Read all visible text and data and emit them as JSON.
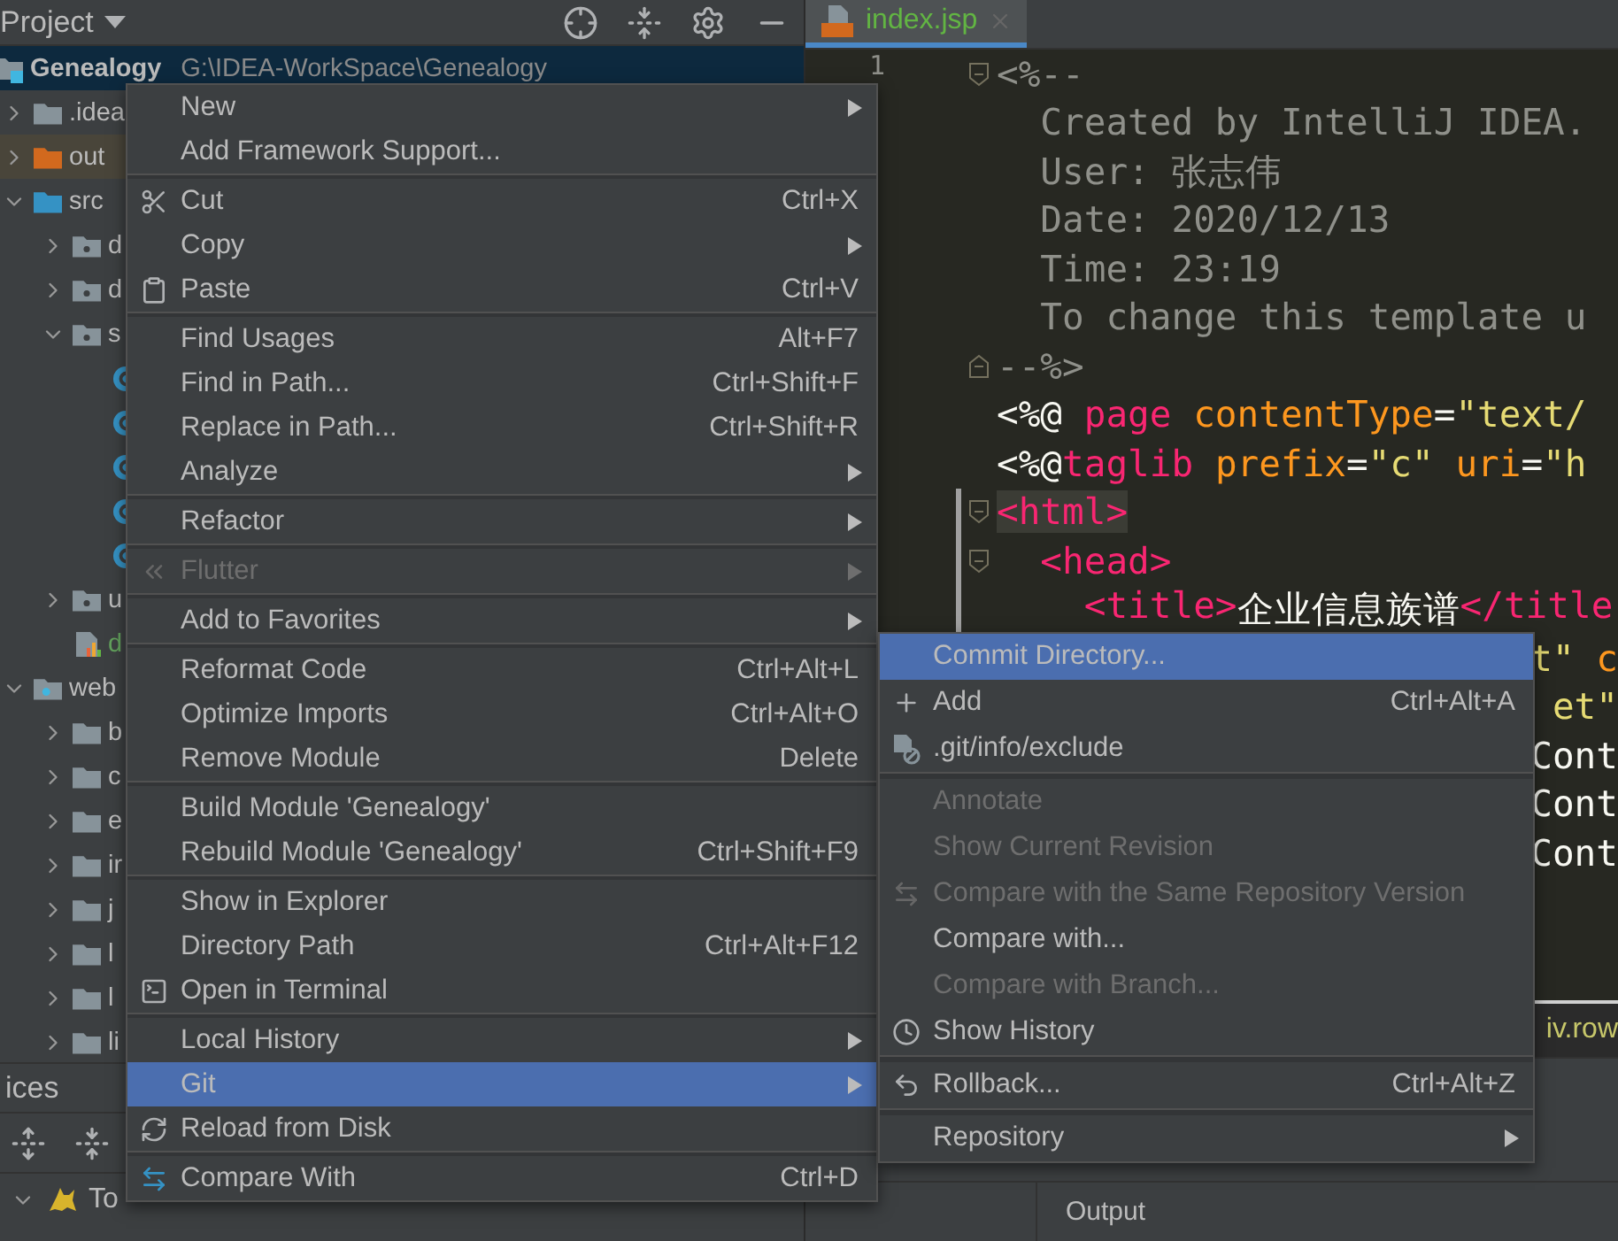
{
  "project_panel": {
    "title": "Project",
    "tree": [
      {
        "name": "Genealogy",
        "path": "G:\\IDEA-WorkSpace\\Genealogy",
        "kind": "module",
        "selected": true,
        "children": [
          {
            "name": ".idea",
            "kind": "folder",
            "expanded": false,
            "selected": false
          },
          {
            "name": "out",
            "kind": "excluded",
            "expanded": false,
            "selected": false
          },
          {
            "name": "src",
            "kind": "source",
            "expanded": true,
            "selected": false,
            "children": [
              {
                "name": "d",
                "kind": "package",
                "expanded": false,
                "selected": false
              },
              {
                "name": "d",
                "kind": "package",
                "expanded": false,
                "selected": false
              },
              {
                "name": "s",
                "kind": "package",
                "expanded": true,
                "selected": false,
                "children": [
                  {
                    "kind": "class",
                    "selected": false
                  },
                  {
                    "kind": "class",
                    "selected": false
                  },
                  {
                    "kind": "class",
                    "selected": false
                  },
                  {
                    "kind": "class",
                    "selected": false
                  },
                  {
                    "kind": "class",
                    "selected": false
                  }
                ]
              },
              {
                "name": "u",
                "kind": "package",
                "expanded": false,
                "selected": false
              },
              {
                "name": "d",
                "kind": "file",
                "selected": false
              }
            ]
          },
          {
            "name": "web",
            "kind": "webroot",
            "expanded": true,
            "selected": false,
            "children": [
              {
                "name": "b",
                "kind": "folder",
                "expanded": false,
                "selected": false
              },
              {
                "name": "c",
                "kind": "folder",
                "expanded": false,
                "selected": false
              },
              {
                "name": "e",
                "kind": "folder",
                "expanded": false,
                "selected": false
              },
              {
                "name": "ir",
                "kind": "folder",
                "expanded": false,
                "selected": false
              },
              {
                "name": "j",
                "kind": "folder",
                "expanded": false,
                "selected": false
              },
              {
                "name": "l",
                "kind": "folder",
                "expanded": false,
                "selected": false
              },
              {
                "name": "l",
                "kind": "folder",
                "expanded": false,
                "selected": false
              },
              {
                "name": "li",
                "kind": "folder",
                "expanded": false,
                "selected": false
              }
            ]
          }
        ]
      }
    ]
  },
  "services_panel": {
    "title": "ices",
    "rows": [
      {
        "name": "To",
        "expanded": true
      }
    ]
  },
  "editor": {
    "tabs": [
      {
        "label": "index.jsp",
        "selected": true
      }
    ],
    "lines": [
      {
        "kind": "fold-start",
        "number": "1",
        "tokens": [
          {
            "text": "<%--",
            "kind": "comment"
          }
        ]
      },
      {
        "kind": "code",
        "tokens": [
          {
            "text": "  Created by IntelliJ IDEA.",
            "kind": "comment"
          }
        ]
      },
      {
        "kind": "code",
        "tokens": [
          {
            "text": "  User: 张志伟",
            "kind": "comment"
          }
        ]
      },
      {
        "kind": "code",
        "tokens": [
          {
            "text": "  Date: 2020/12/13",
            "kind": "comment"
          }
        ]
      },
      {
        "kind": "code",
        "tokens": [
          {
            "text": "  Time: 23:19",
            "kind": "comment"
          }
        ]
      },
      {
        "kind": "code",
        "tokens": [
          {
            "text": "  To change this template u",
            "kind": "comment"
          }
        ]
      },
      {
        "kind": "fold-end",
        "tokens": [
          {
            "text": "--%>",
            "kind": "comment"
          }
        ]
      },
      {
        "kind": "code",
        "tokens": [
          {
            "text": "<%@ ",
            "kind": "plain"
          },
          {
            "text": "page ",
            "kind": "tag"
          },
          {
            "text": "contentType",
            "kind": "attr"
          },
          {
            "text": "=",
            "kind": "plain"
          },
          {
            "text": "\"text/",
            "kind": "string"
          }
        ]
      },
      {
        "kind": "code",
        "tokens": [
          {
            "text": "<%@",
            "kind": "plain"
          },
          {
            "text": "taglib ",
            "kind": "tag"
          },
          {
            "text": "prefix",
            "kind": "attr"
          },
          {
            "text": "=",
            "kind": "plain"
          },
          {
            "text": "\"c\" ",
            "kind": "string"
          },
          {
            "text": "uri",
            "kind": "attr"
          },
          {
            "text": "=",
            "kind": "plain"
          },
          {
            "text": "\"h",
            "kind": "string"
          }
        ]
      },
      {
        "kind": "fold-start",
        "changed": true,
        "tokens": [
          {
            "text": "<html>",
            "kind": "tag",
            "matched": true
          }
        ]
      },
      {
        "kind": "fold-start",
        "changed": true,
        "tokens": [
          {
            "text": "  <head>",
            "kind": "tag"
          }
        ]
      },
      {
        "kind": "code",
        "changed": true,
        "tokens": [
          {
            "text": "    <title>",
            "kind": "tag"
          },
          {
            "text": "企业信息族谱",
            "kind": "plain"
          },
          {
            "text": "</title",
            "kind": "tag"
          }
        ]
      },
      {
        "kind": "fragment",
        "tokens": [
          {
            "text": "t\" ",
            "kind": "string"
          },
          {
            "text": "c",
            "kind": "attr"
          }
        ]
      },
      {
        "kind": "fragment",
        "tokens": [
          {
            "text": "et\"",
            "kind": "string"
          }
        ]
      },
      {
        "kind": "fragment",
        "tokens": [
          {
            "text": "Cont",
            "kind": "plain"
          }
        ]
      },
      {
        "kind": "fragment",
        "tokens": [
          {
            "text": "Cont",
            "kind": "plain"
          }
        ]
      },
      {
        "kind": "fragment",
        "tokens": [
          {
            "text": "Cont",
            "kind": "plain"
          }
        ]
      }
    ],
    "breadcrumb": "iv.row",
    "bottom_tab": "Output"
  },
  "context_menu": {
    "items": [
      {
        "kind": "item",
        "label": "New",
        "submenu": true,
        "disabled": false,
        "selected": false
      },
      {
        "kind": "item",
        "label": "Add Framework Support...",
        "submenu": false,
        "disabled": false,
        "selected": false
      },
      {
        "kind": "separator"
      },
      {
        "kind": "item",
        "label": "Cut",
        "shortcut": "Ctrl+X",
        "submenu": false,
        "disabled": false,
        "selected": false
      },
      {
        "kind": "item",
        "label": "Copy",
        "submenu": true,
        "disabled": false,
        "selected": false
      },
      {
        "kind": "item",
        "label": "Paste",
        "shortcut": "Ctrl+V",
        "submenu": false,
        "disabled": false,
        "selected": false
      },
      {
        "kind": "separator"
      },
      {
        "kind": "item",
        "label": "Find Usages",
        "shortcut": "Alt+F7",
        "submenu": false,
        "disabled": false,
        "selected": false
      },
      {
        "kind": "item",
        "label": "Find in Path...",
        "shortcut": "Ctrl+Shift+F",
        "submenu": false,
        "disabled": false,
        "selected": false
      },
      {
        "kind": "item",
        "label": "Replace in Path...",
        "shortcut": "Ctrl+Shift+R",
        "submenu": false,
        "disabled": false,
        "selected": false
      },
      {
        "kind": "item",
        "label": "Analyze",
        "submenu": true,
        "disabled": false,
        "selected": false
      },
      {
        "kind": "separator"
      },
      {
        "kind": "item",
        "label": "Refactor",
        "submenu": true,
        "disabled": false,
        "selected": false
      },
      {
        "kind": "separator"
      },
      {
        "kind": "item",
        "label": "Flutter",
        "submenu": true,
        "disabled": true,
        "selected": false
      },
      {
        "kind": "separator"
      },
      {
        "kind": "item",
        "label": "Add to Favorites",
        "submenu": true,
        "disabled": false,
        "selected": false
      },
      {
        "kind": "separator"
      },
      {
        "kind": "item",
        "label": "Reformat Code",
        "shortcut": "Ctrl+Alt+L",
        "submenu": false,
        "disabled": false,
        "selected": false
      },
      {
        "kind": "item",
        "label": "Optimize Imports",
        "shortcut": "Ctrl+Alt+O",
        "submenu": false,
        "disabled": false,
        "selected": false
      },
      {
        "kind": "item",
        "label": "Remove Module",
        "shortcut": "Delete",
        "submenu": false,
        "disabled": false,
        "selected": false
      },
      {
        "kind": "separator"
      },
      {
        "kind": "item",
        "label": "Build Module 'Genealogy'",
        "submenu": false,
        "disabled": false,
        "selected": false
      },
      {
        "kind": "item",
        "label": "Rebuild Module 'Genealogy'",
        "shortcut": "Ctrl+Shift+F9",
        "submenu": false,
        "disabled": false,
        "selected": false
      },
      {
        "kind": "separator"
      },
      {
        "kind": "item",
        "label": "Show in Explorer",
        "submenu": false,
        "disabled": false,
        "selected": false
      },
      {
        "kind": "item",
        "label": "Directory Path",
        "shortcut": "Ctrl+Alt+F12",
        "submenu": false,
        "disabled": false,
        "selected": false
      },
      {
        "kind": "item",
        "label": "Open in Terminal",
        "submenu": false,
        "disabled": false,
        "selected": false
      },
      {
        "kind": "separator"
      },
      {
        "kind": "item",
        "label": "Local History",
        "submenu": true,
        "disabled": false,
        "selected": false
      },
      {
        "kind": "item",
        "label": "Git",
        "submenu": true,
        "disabled": false,
        "selected": true
      },
      {
        "kind": "item",
        "label": "Reload from Disk",
        "submenu": false,
        "disabled": false,
        "selected": false
      },
      {
        "kind": "separator"
      },
      {
        "kind": "item",
        "label": "Compare With",
        "shortcut": "Ctrl+D",
        "submenu": false,
        "disabled": false,
        "selected": false
      }
    ]
  },
  "git_submenu": {
    "items": [
      {
        "kind": "item",
        "label": "Commit Directory...",
        "submenu": false,
        "disabled": false,
        "selected": true
      },
      {
        "kind": "item",
        "label": "Add",
        "shortcut": "Ctrl+Alt+A",
        "submenu": false,
        "disabled": false,
        "selected": false
      },
      {
        "kind": "item",
        "label": ".git/info/exclude",
        "submenu": false,
        "disabled": false,
        "selected": false
      },
      {
        "kind": "separator"
      },
      {
        "kind": "item",
        "label": "Annotate",
        "submenu": false,
        "disabled": true,
        "selected": false
      },
      {
        "kind": "item",
        "label": "Show Current Revision",
        "submenu": false,
        "disabled": true,
        "selected": false
      },
      {
        "kind": "item",
        "label": "Compare with the Same Repository Version",
        "submenu": false,
        "disabled": true,
        "selected": false
      },
      {
        "kind": "item",
        "label": "Compare with...",
        "submenu": false,
        "disabled": false,
        "selected": false
      },
      {
        "kind": "item",
        "label": "Compare with Branch...",
        "submenu": false,
        "disabled": true,
        "selected": false
      },
      {
        "kind": "item",
        "label": "Show History",
        "submenu": false,
        "disabled": false,
        "selected": false
      },
      {
        "kind": "separator"
      },
      {
        "kind": "item",
        "label": "Rollback...",
        "shortcut": "Ctrl+Alt+Z",
        "submenu": false,
        "disabled": false,
        "selected": false
      },
      {
        "kind": "separator"
      },
      {
        "kind": "item",
        "label": "Repository",
        "submenu": true,
        "disabled": false,
        "selected": false
      }
    ]
  }
}
